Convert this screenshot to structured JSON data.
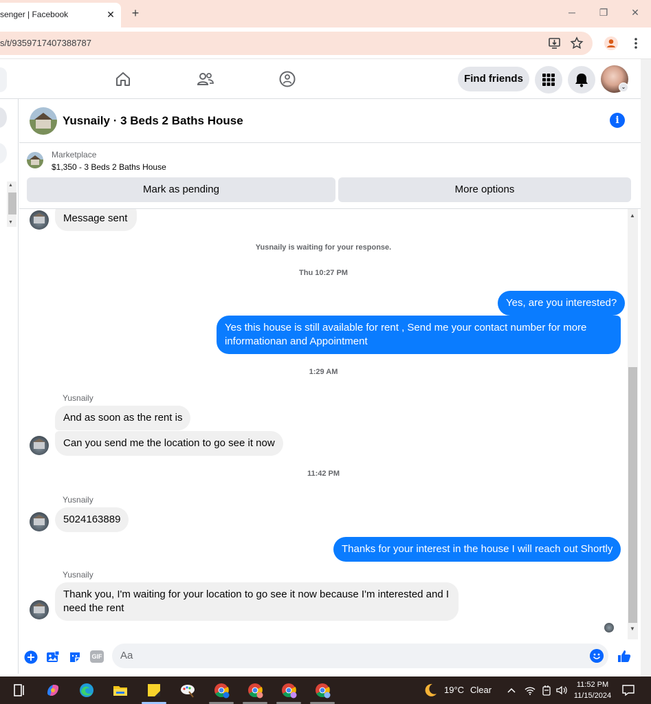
{
  "browser": {
    "tab_title": "senger | Facebook",
    "tab_close": "✕",
    "new_tab": "+",
    "url": "s/t/9359717407388787",
    "minimize": "─",
    "restore": "❐",
    "close": "✕"
  },
  "fb_nav": {
    "find_friends_label": "Find friends"
  },
  "chat": {
    "title": "Yusnaily · 3 Beds 2 Baths House",
    "info_glyph": "i",
    "marketplace_label": "Marketplace",
    "listing": "$1,350 - 3 Beds 2 Baths House",
    "mark_pending_label": "Mark as pending",
    "more_options_label": "More options"
  },
  "messages": {
    "first_bubble": "Message sent",
    "waiting_notice": "Yusnaily is waiting for your response.",
    "stamp_1": "Thu 10:27 PM",
    "out_1": "Yes, are you interested?",
    "out_2": "Yes this house is still available for rent , Send me your contact number for more informationan and Appointment",
    "stamp_2": "1:29 AM",
    "sender_1": "Yusnaily",
    "in_1": "And as soon as the rent is",
    "in_2": "Can you send me the location to go see it now",
    "stamp_3": "11:42 PM",
    "sender_2": "Yusnaily",
    "in_3": "5024163889",
    "out_3": "Thanks for your interest in the house I will reach out Shortly",
    "sender_3": "Yusnaily",
    "in_4": "Thank you, I'm waiting for your location to go see it now because I'm interested and I need the rent"
  },
  "composer": {
    "placeholder": "Aa",
    "gif_label": "GIF"
  },
  "taskbar": {
    "weather_temp": "19°C",
    "weather_desc": "Clear",
    "time": "11:52 PM",
    "date": "11/15/2024"
  },
  "colors": {
    "messenger_blue": "#0a7cff",
    "fb_blue": "#0866ff",
    "tab_bg": "#fbe3da"
  }
}
